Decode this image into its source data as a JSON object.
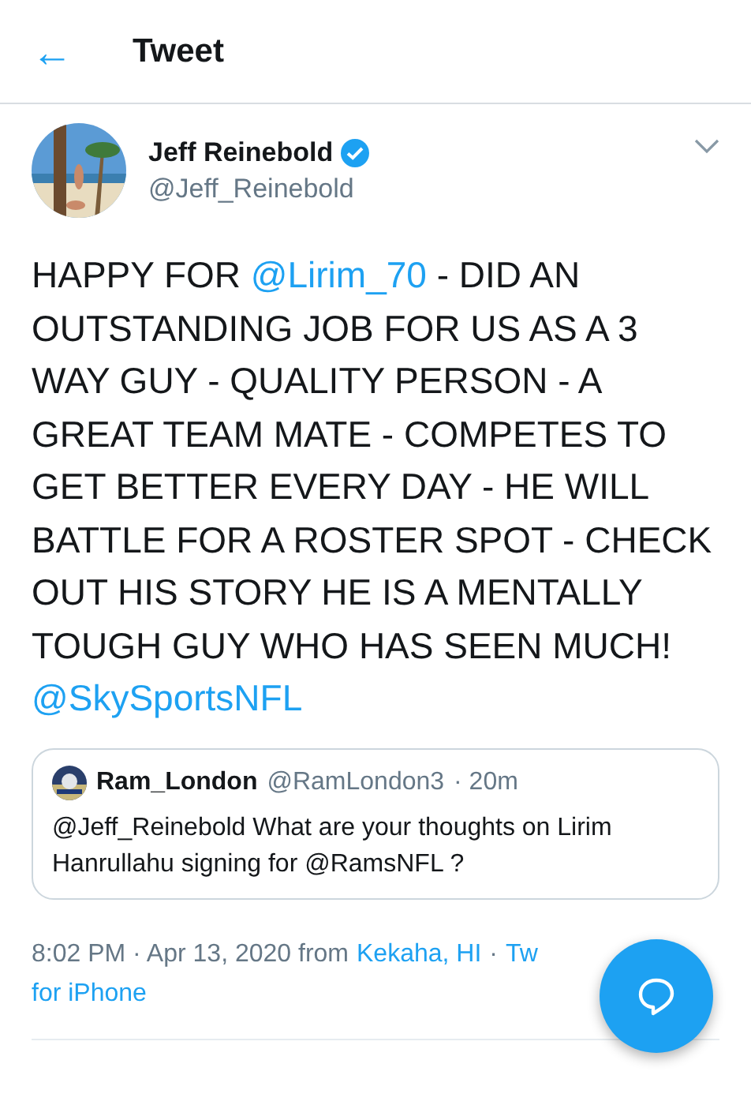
{
  "header": {
    "back_icon": "←",
    "title": "Tweet"
  },
  "author": {
    "name": "Jeff Reinebold",
    "verified": true,
    "handle": "@Jeff_Reinebold"
  },
  "body": [
    {
      "kind": "text",
      "text": "HAPPY FOR "
    },
    {
      "kind": "mention",
      "text": "@Lirim_70"
    },
    {
      "kind": "text",
      "text": " - DID AN OUTSTANDING JOB FOR US AS A 3 WAY GUY - QUALITY PERSON - A GREAT TEAM MATE - COMPETES TO GET BETTER EVERY DAY - HE WILL BATTLE FOR A ROSTER SPOT - CHECK OUT HIS STORY HE IS A MENTALLY TOUGH GUY WHO HAS SEEN MUCH! "
    },
    {
      "kind": "mention",
      "text": "@SkySportsNFL"
    }
  ],
  "quoted": {
    "name": "Ram_London",
    "handle": "@RamLondon3",
    "time": "· 20m",
    "text": "@Jeff_Reinebold What are your thoughts on Lirim Hanrullahu signing for @RamsNFL ?"
  },
  "meta": {
    "timestamp": "8:02 PM · Apr 13, 2020 from",
    "location": "Kekaha, HI",
    "separator": "·",
    "source": "Tw",
    "source_cont": "for iPhone"
  }
}
